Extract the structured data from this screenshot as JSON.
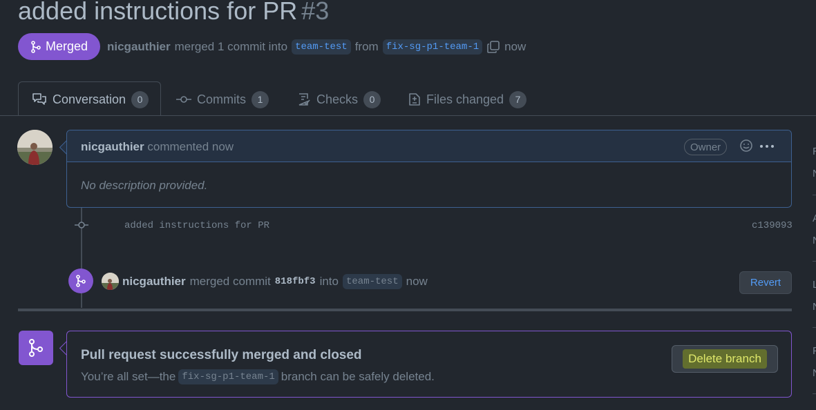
{
  "pr": {
    "title": "added instructions for PR",
    "number": "#3",
    "state_label": "Merged",
    "author": "nicgauthier",
    "merged_text": "merged 1 commit into",
    "base_branch": "team-test",
    "from_text": "from",
    "head_branch": "fix-sg-p1-team-1",
    "time": "now"
  },
  "tabs": [
    {
      "label": "Conversation",
      "count": "0"
    },
    {
      "label": "Commits",
      "count": "1"
    },
    {
      "label": "Checks",
      "count": "0"
    },
    {
      "label": "Files changed",
      "count": "7"
    }
  ],
  "comment": {
    "author": "nicgauthier",
    "action": "commented now",
    "role": "Owner",
    "body": "No description provided."
  },
  "commit": {
    "message": "added instructions for PR",
    "sha": "c139093"
  },
  "merge_event": {
    "author": "nicgauthier",
    "text": "merged commit",
    "sha": "818fbf3",
    "into": "into",
    "branch": "team-test",
    "time": "now",
    "revert_label": "Revert"
  },
  "merged_box": {
    "title": "Pull request successfully merged and closed",
    "desc_before": "You’re all set—the",
    "branch": "fix-sg-p1-team-1",
    "desc_after": "branch can be safely deleted.",
    "delete_label": "Delete branch"
  },
  "sidebar_fragments": [
    "R",
    "N",
    "A",
    "N",
    "L",
    "N",
    "P",
    "N"
  ],
  "colors": {
    "background": "#22272e",
    "merged_purple": "#8256d0",
    "link_blue": "#539bf5",
    "highlight": "#dfe86a"
  }
}
